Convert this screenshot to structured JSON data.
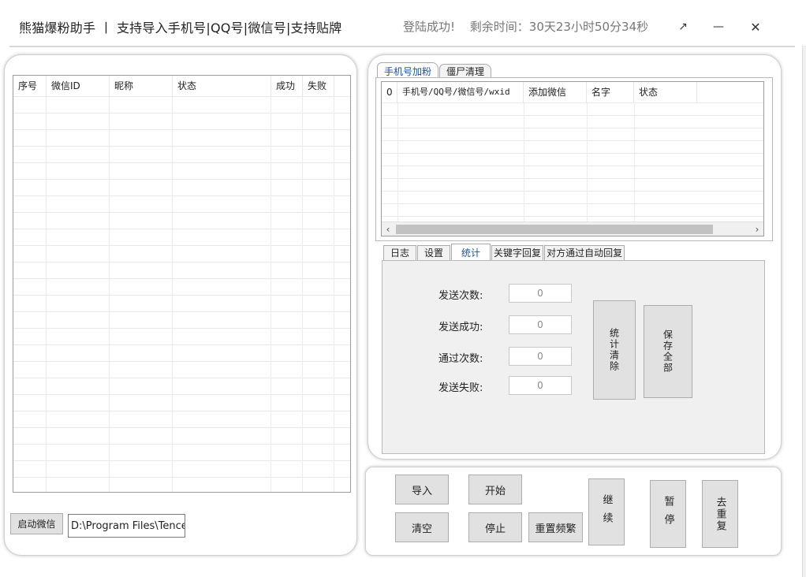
{
  "titlebar": {
    "title": "熊猫爆粉助手 丨 支持导入手机号|QQ号|微信号|支持贴牌",
    "login_status": "登陆成功!",
    "remaining_time": "剩余时间：30天23小时50分34秒",
    "restore_icon": "↗",
    "minimize_icon": "—",
    "close_icon": "✕"
  },
  "left_table": {
    "columns": [
      "序号",
      "微信ID",
      "昵称",
      "状态",
      "成功",
      "失败"
    ],
    "rows": []
  },
  "left_controls": {
    "launch_wechat_label": "启动微信",
    "wechat_path_value": "D:\\Program Files\\Tencent"
  },
  "top_tabs": {
    "items": [
      "手机号加粉",
      "僵尸清理"
    ],
    "active": 0
  },
  "right_table": {
    "columns": [
      "0",
      "手机号/QQ号/微信号/wxid",
      "添加微信",
      "名字",
      "状态"
    ],
    "rows": [],
    "scroll_left_icon": "‹",
    "scroll_right_icon": "›"
  },
  "bottom_tabs": {
    "items": [
      "日志",
      "设置",
      "统计",
      "关键字回复",
      "对方通过自动回复"
    ],
    "active": 2
  },
  "stats": {
    "sent_count_label": "发送次数:",
    "sent_count_value": "0",
    "send_success_label": "发送成功:",
    "send_success_value": "0",
    "pass_count_label": "通过次数:",
    "pass_count_value": "0",
    "send_fail_label": "发送失败:",
    "send_fail_value": "0",
    "clear_stats_label": "统计清除",
    "save_all_label": "保存全部"
  },
  "actions": {
    "import_label": "导入",
    "start_label": "开始",
    "clear_label": "清空",
    "stop_label": "停止",
    "reset_freq_label": "重置频繁",
    "continue_label": "继续",
    "pause_label": "暂停",
    "dedupe_label": "去重复"
  }
}
